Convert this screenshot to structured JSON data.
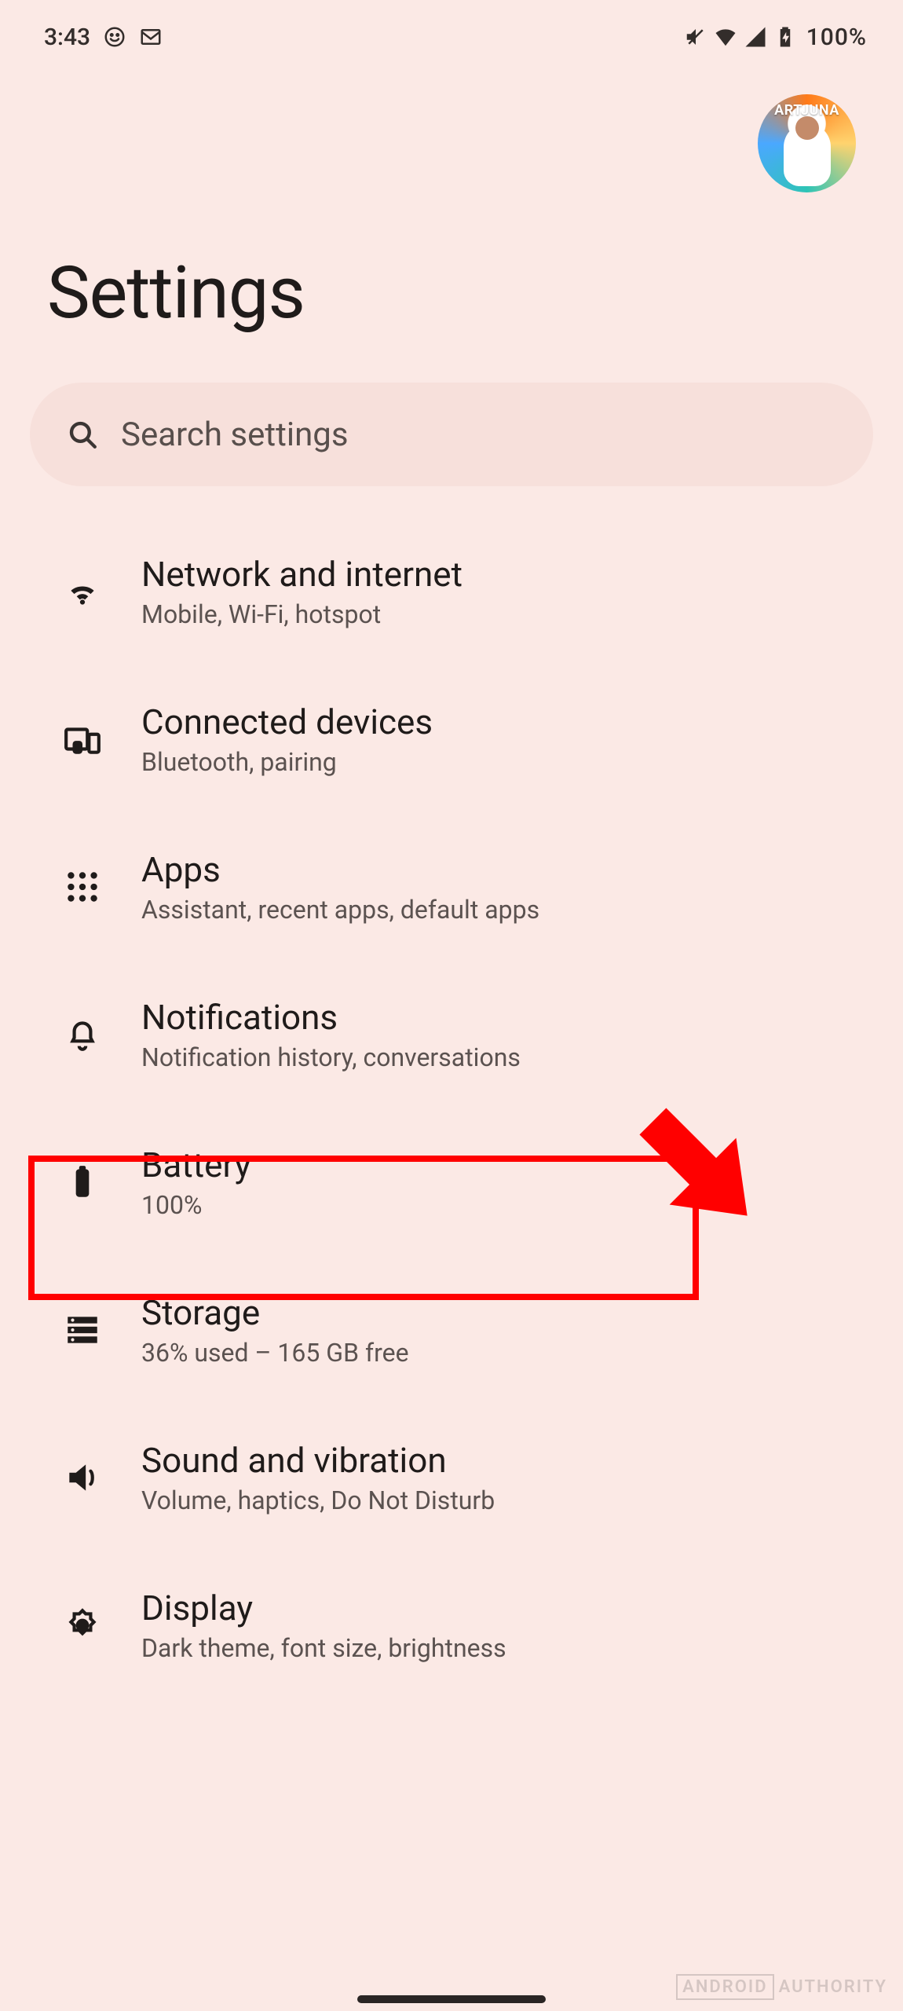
{
  "status": {
    "time": "3:43",
    "battery_text": "100%"
  },
  "header": {
    "title": "Settings",
    "avatar_label": "ARTJUNA"
  },
  "search": {
    "placeholder": "Search settings"
  },
  "items": [
    {
      "key": "network",
      "title": "Network and internet",
      "sub": "Mobile, Wi-Fi, hotspot"
    },
    {
      "key": "devices",
      "title": "Connected devices",
      "sub": "Bluetooth, pairing"
    },
    {
      "key": "apps",
      "title": "Apps",
      "sub": "Assistant, recent apps, default apps"
    },
    {
      "key": "notifs",
      "title": "Notifications",
      "sub": "Notification history, conversations"
    },
    {
      "key": "battery",
      "title": "Battery",
      "sub": "100%"
    },
    {
      "key": "storage",
      "title": "Storage",
      "sub": "36% used – 165 GB free"
    },
    {
      "key": "sound",
      "title": "Sound and vibration",
      "sub": "Volume, haptics, Do Not Disturb"
    },
    {
      "key": "display",
      "title": "Display",
      "sub": "Dark theme, font size, brightness"
    }
  ],
  "watermark": {
    "brand": "ANDROID",
    "site": "AUTHORITY"
  }
}
